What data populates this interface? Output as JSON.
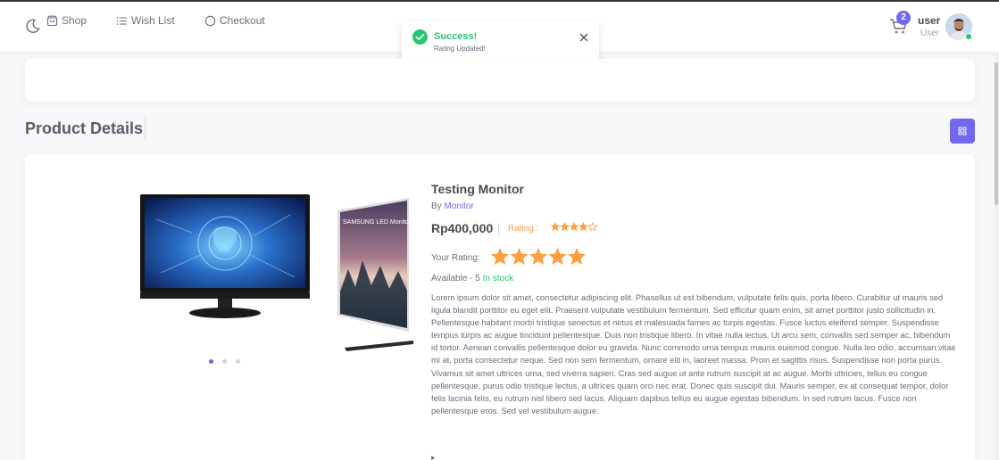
{
  "header": {
    "cart_count": "2",
    "user_name": "user",
    "user_role": "User"
  },
  "toast": {
    "title": "Success!",
    "message": "Rating Updated!"
  },
  "nav": {
    "items": [
      {
        "label": "Shop",
        "icon": "shopping-bag-icon"
      },
      {
        "label": "Wish List",
        "icon": "list-icon"
      },
      {
        "label": "Checkout",
        "icon": "circle-icon"
      }
    ]
  },
  "page": {
    "title": "Product Details"
  },
  "product": {
    "name": "Testing Monitor",
    "by_label": "By",
    "category": "Monitor",
    "price": "Rp400,000",
    "rating_label": "Rating :",
    "rating_value": 4,
    "rating_max": 5,
    "your_rating_label": "Your Rating:",
    "your_rating_value": 5,
    "availability_label": "Available - 5",
    "stock_status": "In stock",
    "description": "Lorem ipsum dolor sit amet, consectetur adipiscing elit. Phasellus ut est bibendum, vulputate felis quis, porta libero. Curabitur ut mauris sed ligula blandit porttitor eu eget elit. Praesent vulputate vestibulum fermentum. Sed efficitur quam enim, sit amet porttitor justo sollicitudin in. Pellentesque habitant morbi tristique senectus et netus et malesuada fames ac turpis egestas. Fusce luctus eleifend semper. Suspendisse tempus turpis ac augue tincidunt pellentesque. Duis non tristique libero. In vitae nulla lectus. Ut arcu sem, convallis sed semper ac, bibendum id tortor. Aenean convallis pellentesque dolor eu gravida. Nunc commodo urna tempus mauris euismod congue. Nulla leo odio, accumsan vitae mi at, porta consectetur neque. Sed non sem fermentum, ornare elit in, laoreet massa. Proin et sagittis risus. Suspendisse non porta purus. Vivamus sit amet ultrices urna, sed viverra sapien. Cras sed augue ut ante rutrum suscipit at ac augue. Morbi ultricies, tellus eu congue pellentesque, purus odio tristique lectus, a ultrices quam orci nec erat. Donec quis suscipit dui. Mauris semper, ex at consequat tempor, dolor felis lacinia felis, eu rutrum nisl libero sed lacus. Aliquam dapibus tellus eu augue egestas bibendum. In sed rutrum lacus. Fusce non pellentesque eros. Sed vel vestibulum augue."
  },
  "gallery": {
    "slide_count": 3,
    "active_slide": 1,
    "second_image_brand": "SAMSUNG LED Monitor"
  },
  "colors": {
    "accent": "#7367f0",
    "success": "#28c76f",
    "star": "#ff9f43"
  }
}
